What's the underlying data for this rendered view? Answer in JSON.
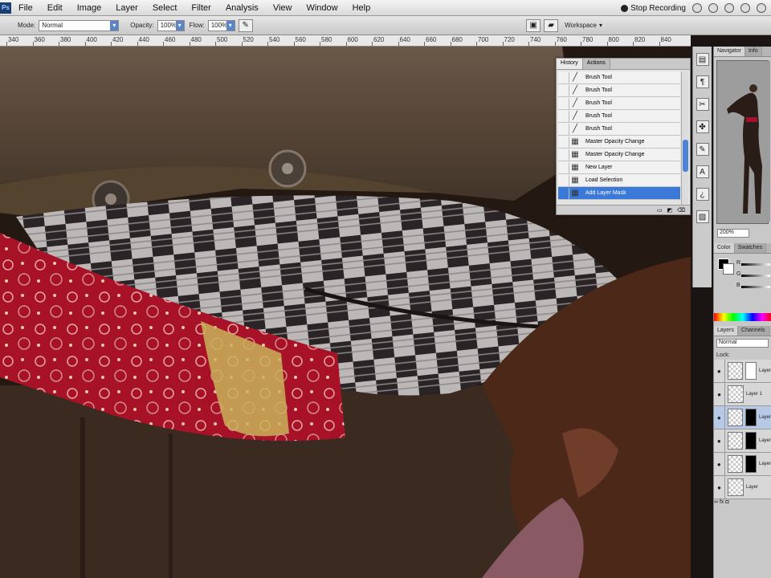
{
  "menubar": {
    "app_icon": "Ps",
    "items": [
      "File",
      "Edit",
      "Image",
      "Layer",
      "Select",
      "Filter",
      "Analysis",
      "View",
      "Window",
      "Help"
    ],
    "stop_recording": "Stop Recording"
  },
  "options": {
    "mode_label": "Mode:",
    "mode_value": "Normal",
    "opacity_label": "Opacity:",
    "opacity_value": "100%",
    "flow_label": "Flow:",
    "flow_value": "100%",
    "workspace_label": "Workspace"
  },
  "ruler": {
    "labels": [
      "340",
      "360",
      "380",
      "400",
      "420",
      "440",
      "460",
      "480",
      "500",
      "520",
      "540",
      "560",
      "580",
      "600",
      "620",
      "640",
      "660",
      "680",
      "700",
      "720",
      "740",
      "760",
      "780",
      "800",
      "820",
      "840"
    ]
  },
  "history": {
    "tabs": [
      "History",
      "Actions"
    ],
    "items": [
      {
        "label": "Brush Tool",
        "icon": "brush-icon"
      },
      {
        "label": "Brush Tool",
        "icon": "brush-icon"
      },
      {
        "label": "Brush Tool",
        "icon": "brush-icon"
      },
      {
        "label": "Brush Tool",
        "icon": "brush-icon"
      },
      {
        "label": "Brush Tool",
        "icon": "brush-icon"
      },
      {
        "label": "Master Opacity Change",
        "icon": "layer-icon"
      },
      {
        "label": "Master Opacity Change",
        "icon": "layer-icon"
      },
      {
        "label": "New Layer",
        "icon": "layer-icon"
      },
      {
        "label": "Load Selection",
        "icon": "layer-icon"
      },
      {
        "label": "Add Layer Mask",
        "icon": "layer-icon"
      }
    ],
    "selected_index": 9
  },
  "navigator": {
    "tabs": [
      "Navigator",
      "Info"
    ],
    "zoom": "200%"
  },
  "color_panel": {
    "tabs": [
      "Color",
      "Swatches"
    ],
    "channels": [
      "R",
      "G",
      "B"
    ],
    "foreground": "#000000",
    "background": "#ffffff"
  },
  "layers": {
    "tabs": [
      "Layers",
      "Channels"
    ],
    "blend_mode": "Normal",
    "lock_label": "Lock:",
    "rows": [
      {
        "name": "Layer",
        "mask": "white"
      },
      {
        "name": "Layer 1",
        "mask": "none"
      },
      {
        "name": "Layer",
        "mask": "black"
      },
      {
        "name": "Layer",
        "mask": "black"
      },
      {
        "name": "Layer",
        "mask": "black"
      },
      {
        "name": "Layer",
        "mask": "none"
      }
    ]
  },
  "colors": {
    "selection": "#3a79d7",
    "panel_bg": "#c8c8c8"
  }
}
